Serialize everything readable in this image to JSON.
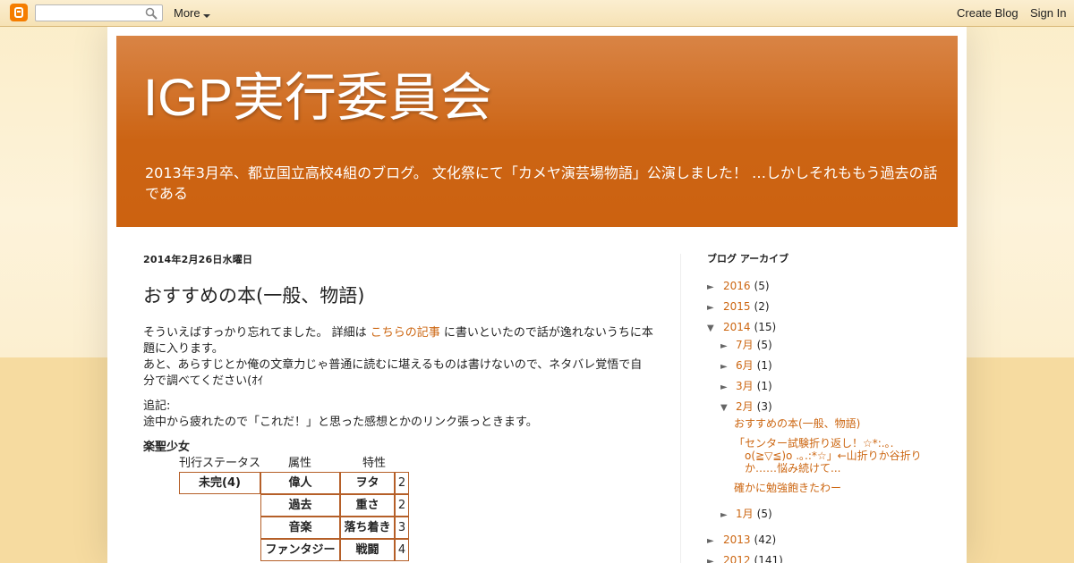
{
  "navbar": {
    "more_label": "More",
    "create_blog_label": "Create Blog",
    "sign_in_label": "Sign In",
    "search_value": ""
  },
  "header": {
    "title": "IGP実行委員会",
    "description": "2013年3月卒、都立国立高校4組のブログ。 文化祭にて「カメヤ演芸場物語」公演しました！ …しかしそれももう過去の話である"
  },
  "post": {
    "date": "2014年2月26日水曜日",
    "title": "おすすめの本(一般、物語)",
    "p1_before": "そういえばすっかり忘れてました。 詳細は ",
    "p1_link": "こちらの記事",
    "p1_after": " に書いといたので話が逸れないうちに本題に入ります。",
    "p2": "あと、あらすじとか俺の文章力じゃ普通に読むに堪えるものは書けないので、ネタバレ覚悟で自分で調べてください(ｵｲ",
    "p3_line1": "追記:",
    "p3_line2": "途中から疲れたので「これだ！」と思った感想とかのリンク張っときます。",
    "book_title": "楽聖少女",
    "table": {
      "headers": [
        "刊行ステータス",
        "属性",
        "特性"
      ],
      "status": "未完(4)",
      "attributes": [
        "偉人",
        "過去",
        "音楽",
        "ファンタジー"
      ],
      "traits": [
        "ヲタ",
        "重さ",
        "落ち着き",
        "戦闘"
      ],
      "scores": [
        "2",
        "2",
        "3",
        "4"
      ]
    }
  },
  "sidebar": {
    "title": "ブログ アーカイブ",
    "years": [
      {
        "label": "2016",
        "count": "(5)",
        "arrow": "►"
      },
      {
        "label": "2015",
        "count": "(2)",
        "arrow": "►"
      },
      {
        "label": "2014",
        "count": "(15)",
        "arrow": "▼"
      }
    ],
    "months": [
      {
        "label": "7月",
        "count": "(5)",
        "arrow": "►"
      },
      {
        "label": "6月",
        "count": "(1)",
        "arrow": "►"
      },
      {
        "label": "3月",
        "count": "(1)",
        "arrow": "►"
      },
      {
        "label": "2月",
        "count": "(3)",
        "arrow": "▼"
      }
    ],
    "posts": [
      "おすすめの本(一般、物語)",
      "「センター試験折り返し！☆*:.｡. o(≧▽≦)o .｡.:*☆」←山折りか谷折りか……悩み続けて...",
      "確かに勉強飽きたわー"
    ],
    "jan": {
      "label": "1月",
      "count": "(5)",
      "arrow": "►"
    },
    "older_years": [
      {
        "label": "2013",
        "count": "(42)",
        "arrow": "►"
      },
      {
        "label": "2012",
        "count": "(141)",
        "arrow": "►"
      }
    ]
  }
}
